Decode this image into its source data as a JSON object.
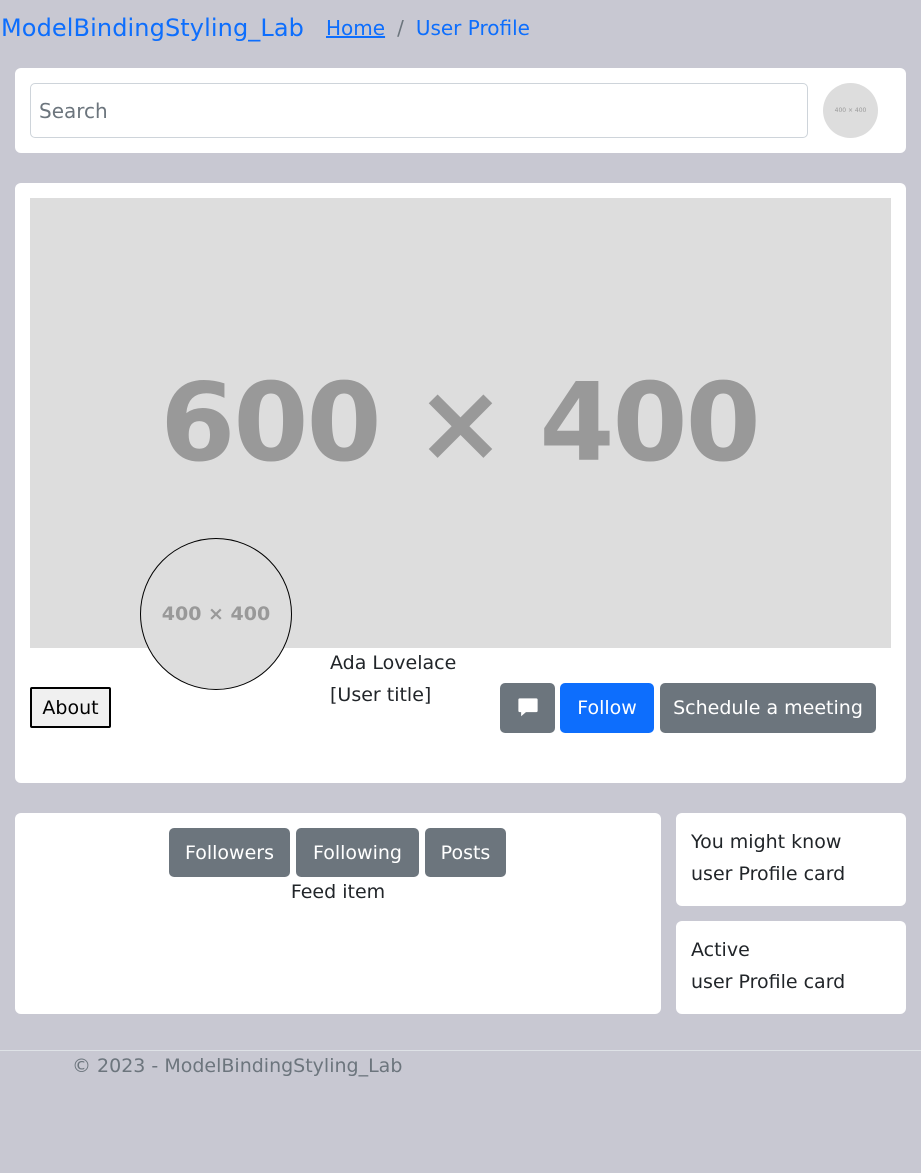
{
  "nav": {
    "brand": "ModelBindingStyling_Lab",
    "breadcrumb": {
      "home": "Home",
      "separator": "/",
      "current": "User Profile"
    }
  },
  "search": {
    "placeholder": "Search",
    "avatar_text": "400 × 400"
  },
  "profile": {
    "cover_text": "600 × 400",
    "avatar_text": "400 × 400",
    "about_label": "About",
    "name": "Ada Lovelace",
    "title": "[User title]",
    "message_icon": "chat-bubble-icon",
    "follow_label": "Follow",
    "schedule_label": "Schedule a meeting"
  },
  "feed": {
    "tabs": [
      "Followers",
      "Following",
      "Posts"
    ],
    "item": "Feed item"
  },
  "sidebar": [
    {
      "heading": "You might know",
      "body": "user Profile card"
    },
    {
      "heading": "Active",
      "body": "user Profile card"
    }
  ],
  "footer": {
    "text": "© 2023 - ModelBindingStyling_Lab"
  },
  "colors": {
    "primary": "#0d6efd",
    "secondary": "#6c757d",
    "page_bg": "#c8c8d2",
    "placeholder": "#dddddd"
  }
}
